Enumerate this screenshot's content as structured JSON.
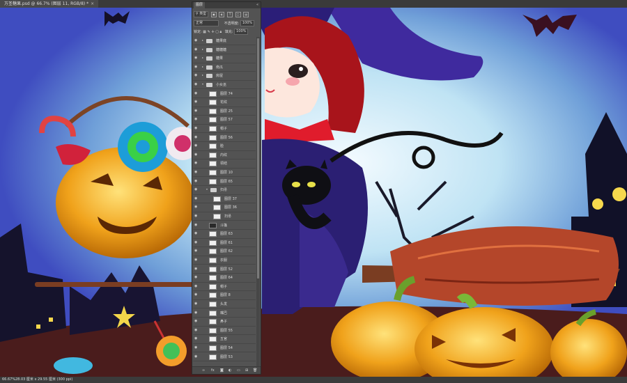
{
  "document": {
    "tab_title": "万圣糖果.psd @ 66.7% (图层 11, RGB/8) *",
    "close_glyph": "×"
  },
  "status": {
    "zoom": "66.67%",
    "info": "28.03 厘米 x 29.55 厘米 (300 ppi)"
  },
  "panel": {
    "tab_label": "图层",
    "collapse_glyph": "«",
    "filter": {
      "kind_label": "类型"
    },
    "blend_mode": "正常",
    "opacity_label": "不透明度:",
    "opacity_value": "100%",
    "lock_label": "锁定:",
    "fill_label": "填充:",
    "fill_value": "100%"
  },
  "layers": [
    {
      "name": "糖果底",
      "type": "group",
      "indent": 0
    },
    {
      "name": "糖糖糖",
      "type": "group",
      "indent": 0
    },
    {
      "name": "糖果",
      "type": "group",
      "indent": 0
    },
    {
      "name": "南瓜",
      "type": "group",
      "indent": 0
    },
    {
      "name": "房屋",
      "type": "group",
      "indent": 0
    },
    {
      "name": "小女巫",
      "type": "group",
      "indent": 0,
      "open": true
    },
    {
      "name": "图层 74",
      "type": "layer",
      "indent": 1
    },
    {
      "name": "花纹",
      "type": "layer",
      "indent": 1
    },
    {
      "name": "图层 25",
      "type": "layer",
      "indent": 1
    },
    {
      "name": "图层 57",
      "type": "layer",
      "indent": 1
    },
    {
      "name": "帽子",
      "type": "layer",
      "indent": 1
    },
    {
      "name": "图层 56",
      "type": "layer",
      "indent": 1
    },
    {
      "name": "脸",
      "type": "layer",
      "indent": 1
    },
    {
      "name": "内纹",
      "type": "layer",
      "indent": 1
    },
    {
      "name": "领结",
      "type": "layer",
      "indent": 1
    },
    {
      "name": "图层 10",
      "type": "layer",
      "indent": 1
    },
    {
      "name": "图层 65",
      "type": "layer",
      "indent": 1
    },
    {
      "name": "扫帚",
      "type": "group",
      "indent": 1,
      "open": true
    },
    {
      "name": "图层 37",
      "type": "layer",
      "indent": 2
    },
    {
      "name": "图层 36",
      "type": "layer",
      "indent": 2
    },
    {
      "name": "扫帚",
      "type": "layer",
      "indent": 2
    },
    {
      "name": "斗篷",
      "type": "layer",
      "indent": 1,
      "dark": true
    },
    {
      "name": "图层 63",
      "type": "layer",
      "indent": 1
    },
    {
      "name": "图层 61",
      "type": "layer",
      "indent": 1
    },
    {
      "name": "图层 62",
      "type": "layer",
      "indent": 1
    },
    {
      "name": "衣服",
      "type": "layer",
      "indent": 1
    },
    {
      "name": "图层 52",
      "type": "layer",
      "indent": 1
    },
    {
      "name": "图层 64",
      "type": "layer",
      "indent": 1
    },
    {
      "name": "帽子",
      "type": "layer",
      "indent": 1
    },
    {
      "name": "图层 8",
      "type": "layer",
      "indent": 1
    },
    {
      "name": "头发",
      "type": "layer",
      "indent": 1
    },
    {
      "name": "嘴巴",
      "type": "layer",
      "indent": 1
    },
    {
      "name": "鼻子",
      "type": "layer",
      "indent": 1
    },
    {
      "name": "图层 55",
      "type": "layer",
      "indent": 1
    },
    {
      "name": "五官",
      "type": "layer",
      "indent": 1
    },
    {
      "name": "图层 54",
      "type": "layer",
      "indent": 1
    },
    {
      "name": "图层 53",
      "type": "layer",
      "indent": 1
    }
  ],
  "icons": {
    "eye": "eye-icon",
    "folder": "folder-icon",
    "foot": [
      "link-icon",
      "fx-icon",
      "mask-icon",
      "adjustment-icon",
      "new-group-icon",
      "new-layer-icon",
      "trash-icon"
    ]
  }
}
